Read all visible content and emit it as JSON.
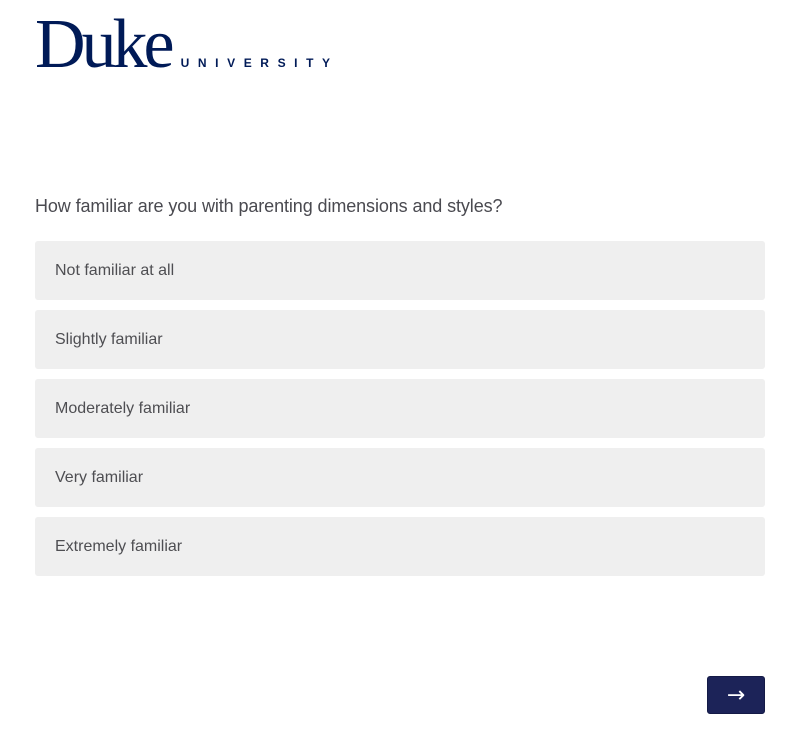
{
  "logo": {
    "wordmark": "Duke",
    "subtext": "UNIVERSITY"
  },
  "survey": {
    "question": "How familiar are you with parenting dimensions and styles?",
    "options": [
      "Not familiar at all",
      "Slightly familiar",
      "Moderately familiar",
      "Very familiar",
      "Extremely familiar"
    ]
  },
  "navigation": {
    "next_icon": "right-arrow",
    "next_glyph": "→"
  },
  "colors": {
    "brand": "#001a57",
    "button": "#1c2358",
    "option_bg": "#efefef",
    "text": "#4a4a50"
  }
}
